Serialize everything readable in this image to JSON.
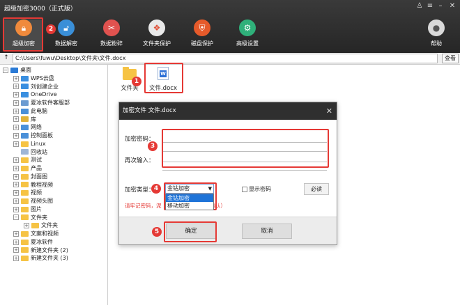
{
  "window": {
    "title": "超级加密3000（正式版）",
    "controls": [
      "shirt-icon",
      "menu-icon",
      "minimize-icon",
      "close-icon"
    ]
  },
  "toolbar": {
    "items": [
      {
        "label": "超级加密",
        "icon": "lock-icon",
        "color": "#f08a3c",
        "active": true
      },
      {
        "label": "数据解密",
        "icon": "unlock-icon",
        "color": "#3a8fd8"
      },
      {
        "label": "数据粉碎",
        "icon": "scissors-icon",
        "color": "#e0524f"
      },
      {
        "label": "文件夹保护",
        "icon": "folder-shield-icon",
        "color": "#e9e9e9"
      },
      {
        "label": "磁盘保护",
        "icon": "shield-icon",
        "color": "#e65a2a"
      },
      {
        "label": "高级设置",
        "icon": "gear-icon",
        "color": "#2fb07a"
      }
    ],
    "help_label": "帮助"
  },
  "pathbar": {
    "up": "↑",
    "path": "C:\\Users\\fuwu\\Desktop\\文件夹\\文件.docx",
    "view_label": "查看"
  },
  "tree": [
    {
      "label": "桌面",
      "level": 0,
      "exp": "minus",
      "color": "#2b7bd6"
    },
    {
      "label": "WPS云盘",
      "level": 1,
      "exp": "plus",
      "color": "#3a8fe0"
    },
    {
      "label": "刘创建企业",
      "level": 1,
      "exp": "plus",
      "color": "#3a8fe0"
    },
    {
      "label": "OneDrive",
      "level": 1,
      "exp": "plus",
      "color": "#3a8fe0"
    },
    {
      "label": "夏冰软件客服部",
      "level": 1,
      "exp": "plus",
      "color": "#6b9bd1"
    },
    {
      "label": "此电脑",
      "level": 1,
      "exp": "plus",
      "color": "#4a90d9"
    },
    {
      "label": "库",
      "level": 1,
      "exp": "plus",
      "color": "#e0b23a"
    },
    {
      "label": "网络",
      "level": 1,
      "exp": "plus",
      "color": "#4a90d9"
    },
    {
      "label": "控制面板",
      "level": 1,
      "exp": "plus",
      "color": "#4a90d9"
    },
    {
      "label": "Linux",
      "level": 1,
      "exp": "plus",
      "color": "#f6c344"
    },
    {
      "label": "回收站",
      "level": 1,
      "exp": "none",
      "color": "#9fb6d6"
    },
    {
      "label": "测试",
      "level": 1,
      "exp": "plus",
      "color": "#f6c344"
    },
    {
      "label": "产品",
      "level": 1,
      "exp": "plus",
      "color": "#f6c344"
    },
    {
      "label": "封面图",
      "level": 1,
      "exp": "plus",
      "color": "#f6c344"
    },
    {
      "label": "教程视频",
      "level": 1,
      "exp": "plus",
      "color": "#f6c344"
    },
    {
      "label": "视频",
      "level": 1,
      "exp": "plus",
      "color": "#f6c344"
    },
    {
      "label": "视频头图",
      "level": 1,
      "exp": "plus",
      "color": "#f6c344"
    },
    {
      "label": "图片",
      "level": 1,
      "exp": "plus",
      "color": "#f6c344"
    },
    {
      "label": "文件夹",
      "level": 1,
      "exp": "minus",
      "color": "#f6c344"
    },
    {
      "label": "文件夹",
      "level": 2,
      "exp": "plus",
      "color": "#f6c344"
    },
    {
      "label": "文案和视频",
      "level": 1,
      "exp": "plus",
      "color": "#f6c344"
    },
    {
      "label": "夏冰软件",
      "level": 1,
      "exp": "plus",
      "color": "#f6c344"
    },
    {
      "label": "新建文件夹 (2)",
      "level": 1,
      "exp": "plus",
      "color": "#f6c344"
    },
    {
      "label": "新建文件夹 (3)",
      "level": 1,
      "exp": "plus",
      "color": "#f6c344"
    }
  ],
  "files": [
    {
      "name": "文件夹",
      "icon": "folder-icon"
    },
    {
      "name": "文件.docx",
      "icon": "word-doc-icon"
    }
  ],
  "dialog": {
    "title": "加密文件 文件.docx",
    "password_label": "加密密码：",
    "confirm_label": "再次输入：",
    "type_label": "加密类型：",
    "type_selected": "金钻加密",
    "type_options": [
      "金钻加密",
      "移动加密"
    ],
    "show_password": "显示密码",
    "readme": "必读",
    "warning": "请牢记密码，泥                                          （建议显示密码进行确认）",
    "ok": "确定",
    "cancel": "取消"
  },
  "steps": [
    "1",
    "2",
    "3",
    "4",
    "5"
  ],
  "colors": {
    "highlight": "#e53935",
    "accent": "#1e73d8"
  }
}
